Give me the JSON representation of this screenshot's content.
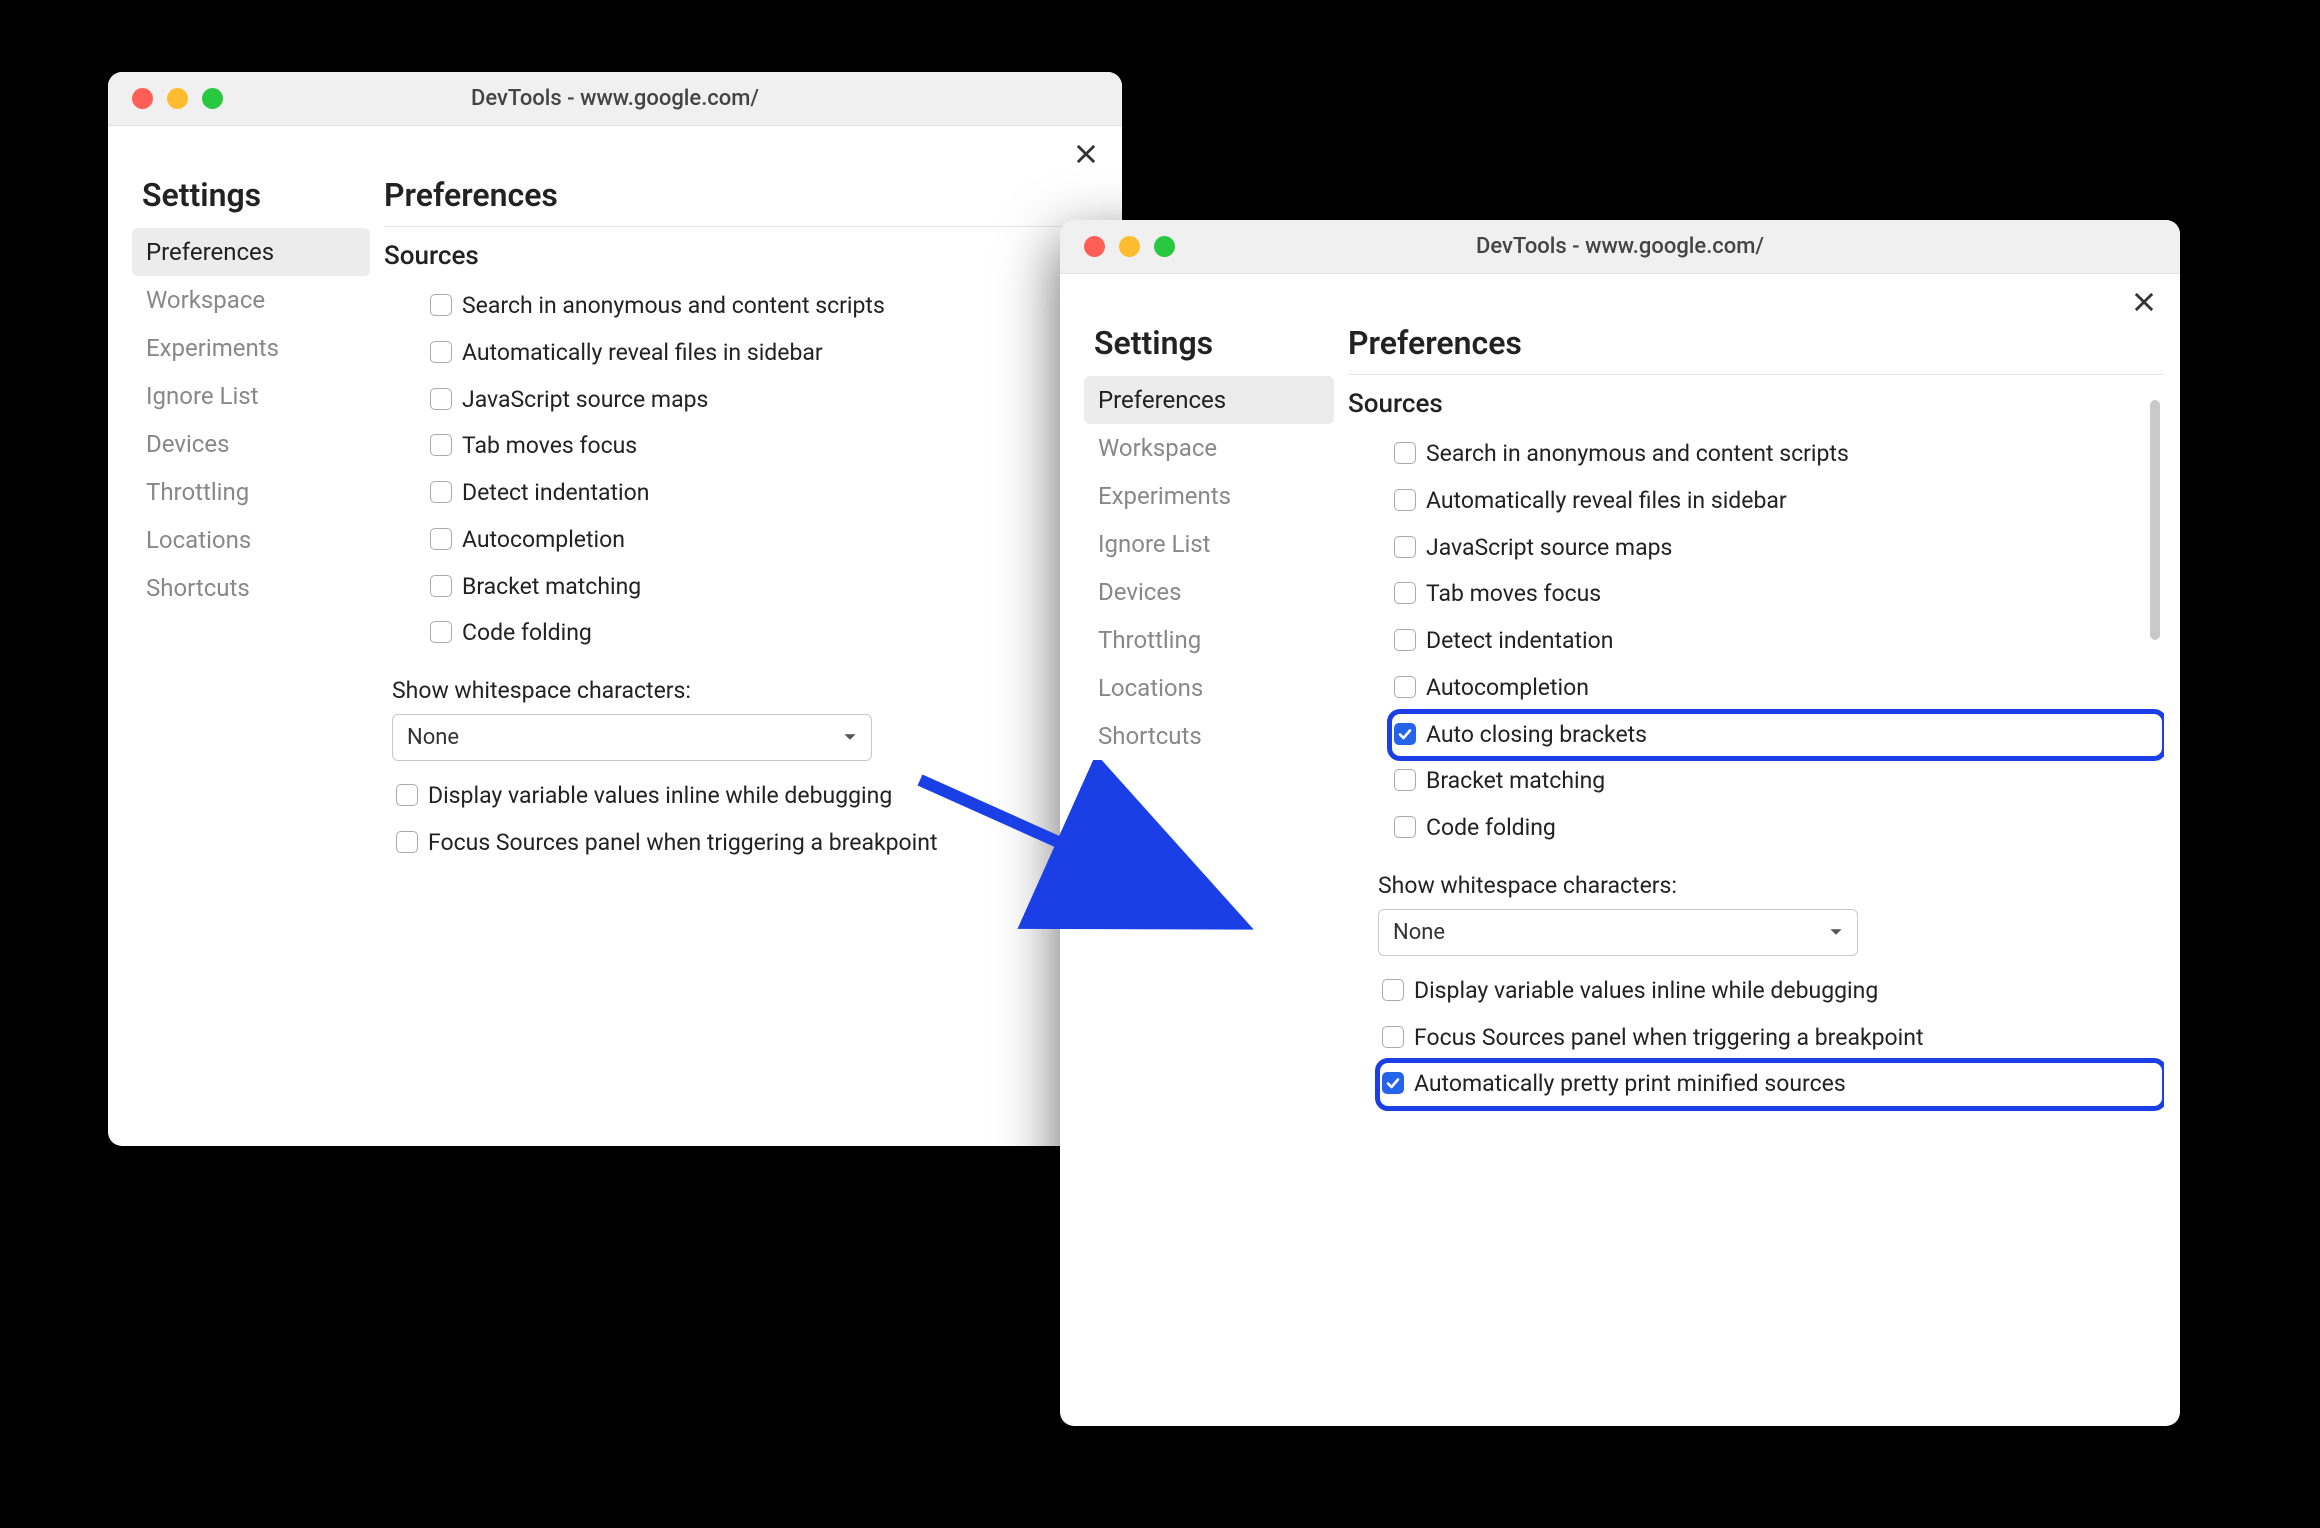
{
  "window_title": "DevTools - www.google.com/",
  "sidebar": {
    "heading": "Settings",
    "items": [
      {
        "label": "Preferences",
        "selected": true
      },
      {
        "label": "Workspace",
        "selected": false
      },
      {
        "label": "Experiments",
        "selected": false
      },
      {
        "label": "Ignore List",
        "selected": false
      },
      {
        "label": "Devices",
        "selected": false
      },
      {
        "label": "Throttling",
        "selected": false
      },
      {
        "label": "Locations",
        "selected": false
      },
      {
        "label": "Shortcuts",
        "selected": false
      }
    ]
  },
  "main_heading": "Preferences",
  "section_heading": "Sources",
  "whitespace_label": "Show whitespace characters:",
  "whitespace_value": "None",
  "left_options": [
    {
      "label": "Search in anonymous and content scripts",
      "checked": false
    },
    {
      "label": "Automatically reveal files in sidebar",
      "checked": false
    },
    {
      "label": "JavaScript source maps",
      "checked": false
    },
    {
      "label": "Tab moves focus",
      "checked": false
    },
    {
      "label": "Detect indentation",
      "checked": false
    },
    {
      "label": "Autocompletion",
      "checked": false
    },
    {
      "label": "Bracket matching",
      "checked": false
    },
    {
      "label": "Code folding",
      "checked": false
    }
  ],
  "left_options_tail": [
    {
      "label": "Display variable values inline while debugging",
      "checked": false
    },
    {
      "label": "Focus Sources panel when triggering a breakpoint",
      "checked": false
    }
  ],
  "right_options": [
    {
      "label": "Search in anonymous and content scripts",
      "checked": false,
      "highlight": false
    },
    {
      "label": "Automatically reveal files in sidebar",
      "checked": false,
      "highlight": false
    },
    {
      "label": "JavaScript source maps",
      "checked": false,
      "highlight": false
    },
    {
      "label": "Tab moves focus",
      "checked": false,
      "highlight": false
    },
    {
      "label": "Detect indentation",
      "checked": false,
      "highlight": false
    },
    {
      "label": "Autocompletion",
      "checked": false,
      "highlight": false
    },
    {
      "label": "Auto closing brackets",
      "checked": true,
      "highlight": true
    },
    {
      "label": "Bracket matching",
      "checked": false,
      "highlight": false
    },
    {
      "label": "Code folding",
      "checked": false,
      "highlight": false
    }
  ],
  "right_options_tail": [
    {
      "label": "Display variable values inline while debugging",
      "checked": false,
      "highlight": false
    },
    {
      "label": "Focus Sources panel when triggering a breakpoint",
      "checked": false,
      "highlight": false
    },
    {
      "label": "Automatically pretty print minified sources",
      "checked": true,
      "highlight": true
    }
  ],
  "colors": {
    "highlight": "#1a3fe6",
    "checkbox_checked": "#2563eb"
  }
}
